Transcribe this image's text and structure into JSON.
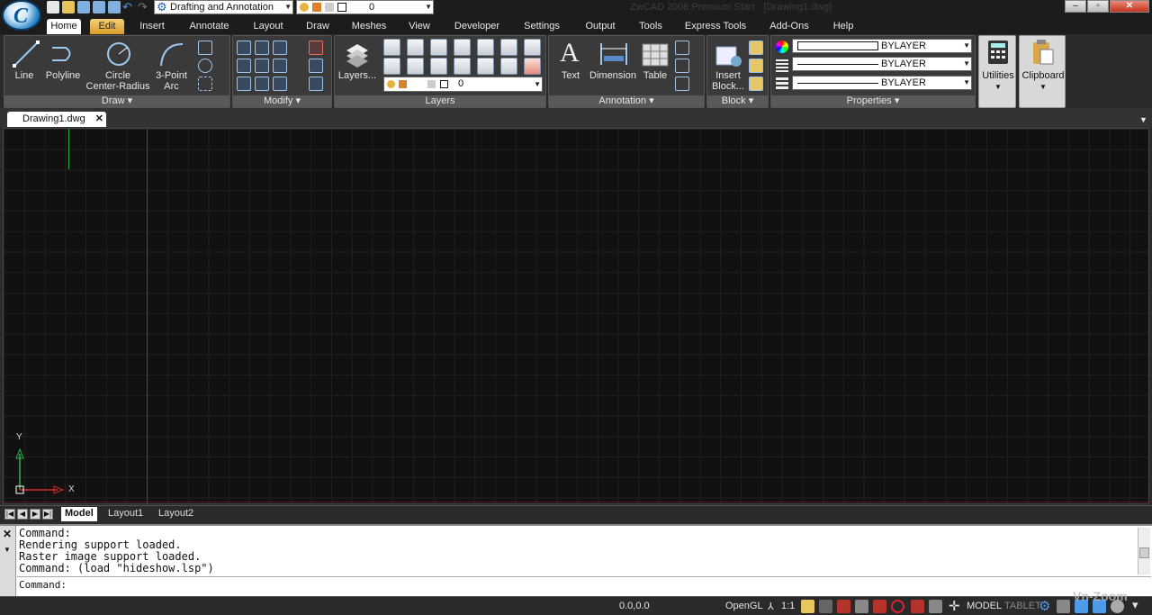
{
  "title_bar": {
    "workspace": "Drafting and Annotation",
    "layer_value": "0",
    "app_title": "ZwCAD 2008 Premium Start - [Drawing1.dwg]",
    "window_buttons": [
      "–",
      "▫",
      "✕"
    ]
  },
  "ribbon_tabs": [
    "Home",
    "Edit",
    "Insert",
    "Annotate",
    "Layout",
    "Draw",
    "Meshes",
    "View",
    "Developer",
    "Settings",
    "Output",
    "Tools",
    "Express Tools",
    "Add-Ons",
    "Help"
  ],
  "ribbon_active_tab": "Home",
  "panels": {
    "draw": {
      "label": "Draw",
      "line": "Line",
      "polyline": "Polyline",
      "circle_1": "Circle",
      "circle_2": "Center-Radius",
      "arc_1": "3-Point",
      "arc_2": "Arc"
    },
    "modify": {
      "label": "Modify"
    },
    "layers": {
      "label": "Layers",
      "button": "Layers...",
      "layer_value": "0"
    },
    "annotation": {
      "label": "Annotation",
      "text": "Text",
      "dimension": "Dimension",
      "table": "Table"
    },
    "block": {
      "label": "Block",
      "insert_1": "Insert",
      "insert_2": "Block..."
    },
    "properties": {
      "label": "Properties",
      "color": "BYLAYER",
      "linetype": "BYLAYER",
      "lineweight": "BYLAYER"
    },
    "utilities": {
      "label": "Utilities"
    },
    "clipboard": {
      "label": "Clipboard"
    }
  },
  "document_tab": {
    "name": "Drawing1.dwg",
    "close": "✕"
  },
  "canvas": {
    "axis_y": "Y",
    "axis_x": "X"
  },
  "layout_tabs": [
    "Model",
    "Layout1",
    "Layout2"
  ],
  "command_history": [
    "Command:",
    "Rendering support loaded.",
    "Raster image support loaded.",
    "Command: (load \"hideshow.lsp\")"
  ],
  "command_prompt": "Command:",
  "status_bar": {
    "coordinates": "0.0,0.0",
    "render_mode": "OpenGL",
    "scale": "1:1",
    "model": "MODEL",
    "tablet": "TABLET",
    "watermark": "Vn-Zoom"
  },
  "colors": {
    "accent": "#f0b43c",
    "canvas_bg": "#111111",
    "ribbon_bg": "#3a3a3a"
  }
}
